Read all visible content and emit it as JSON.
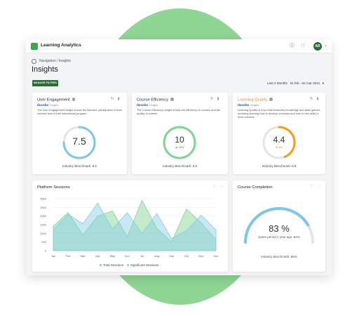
{
  "header": {
    "app_title": "Learning Analytics",
    "help_icon": "help-circle-icon",
    "apps_icon": "grid-icon",
    "avatar_initials": "AR"
  },
  "breadcrumb": "Navigation / Insights",
  "page_title": "Insights",
  "manage_filters_label": "MANAGE FILTERS",
  "date_range": {
    "label": "Last 2 Months",
    "range": "01 feb - 02 mar 2021"
  },
  "colors": {
    "brand_green": "#2f6b38",
    "engagement_ring": "#7ec7ea",
    "efficiency_ring": "#7fd68e",
    "quality_ring": "#f39c1f",
    "total_sessions": "#7fd48a",
    "significant_sessions": "#86cbea"
  },
  "cards": [
    {
      "title": "User Engagement",
      "brand": "docebo",
      "brand_sub": "Insights",
      "description": "The User Engagement widget shows the learners' participation in their courses and in their educational program",
      "value": "7.5",
      "delta": "",
      "progress": 0.75,
      "benchmark": "Industry Benchmark: 8.6"
    },
    {
      "title": "Course Efficiency",
      "brand": "docebo",
      "brand_sub": "Insights",
      "description": "The Course Efficiency widget shows the efficiency of courses and the quality of content",
      "value": "10",
      "delta": "▲ 18%",
      "progress": 1.0,
      "benchmark": "Industry Benchmark: 8.8"
    },
    {
      "title": "Learning Quality",
      "brand": "docebo",
      "brand_sub": "Insights",
      "description": "Learning Quality is a kpi that measures knowledge and skills gained, including learning how to develop concepts and how to use skills to drive success",
      "value": "4.4",
      "delta": "▼ 8%",
      "progress": 0.44,
      "benchmark": "Industry Benchmark: 8.8"
    }
  ],
  "sessions_card": {
    "title": "Platform Sessions"
  },
  "chart_data": {
    "type": "area",
    "title": "Platform Sessions",
    "categories": [
      "Jan",
      "Feb",
      "Mar",
      "Apr",
      "May",
      "Jun",
      "Jul",
      "Aug",
      "Sep",
      "Oct",
      "Nov",
      "Dec"
    ],
    "ylim": [
      0,
      3000
    ],
    "yticks": [
      "3000",
      "2500",
      "2000",
      "1500",
      "1000",
      "500",
      "0"
    ],
    "series": [
      {
        "name": "Total Sessions",
        "values": [
          1400,
          2200,
          900,
          2000,
          2300,
          800,
          2900,
          1300,
          500,
          2400,
          1600,
          650
        ]
      },
      {
        "name": "Significant Sessions",
        "values": [
          1200,
          2100,
          1550,
          2750,
          1250,
          2200,
          1000,
          2150,
          700,
          1150,
          2050,
          1200
        ]
      }
    ],
    "legend": "bottom"
  },
  "completion_card": {
    "title": "Course Completion",
    "value": "83 %",
    "progress": 0.83,
    "previous": "Same period 1 year ago: 84%",
    "benchmark": "Industry Benchmark: 85%"
  }
}
